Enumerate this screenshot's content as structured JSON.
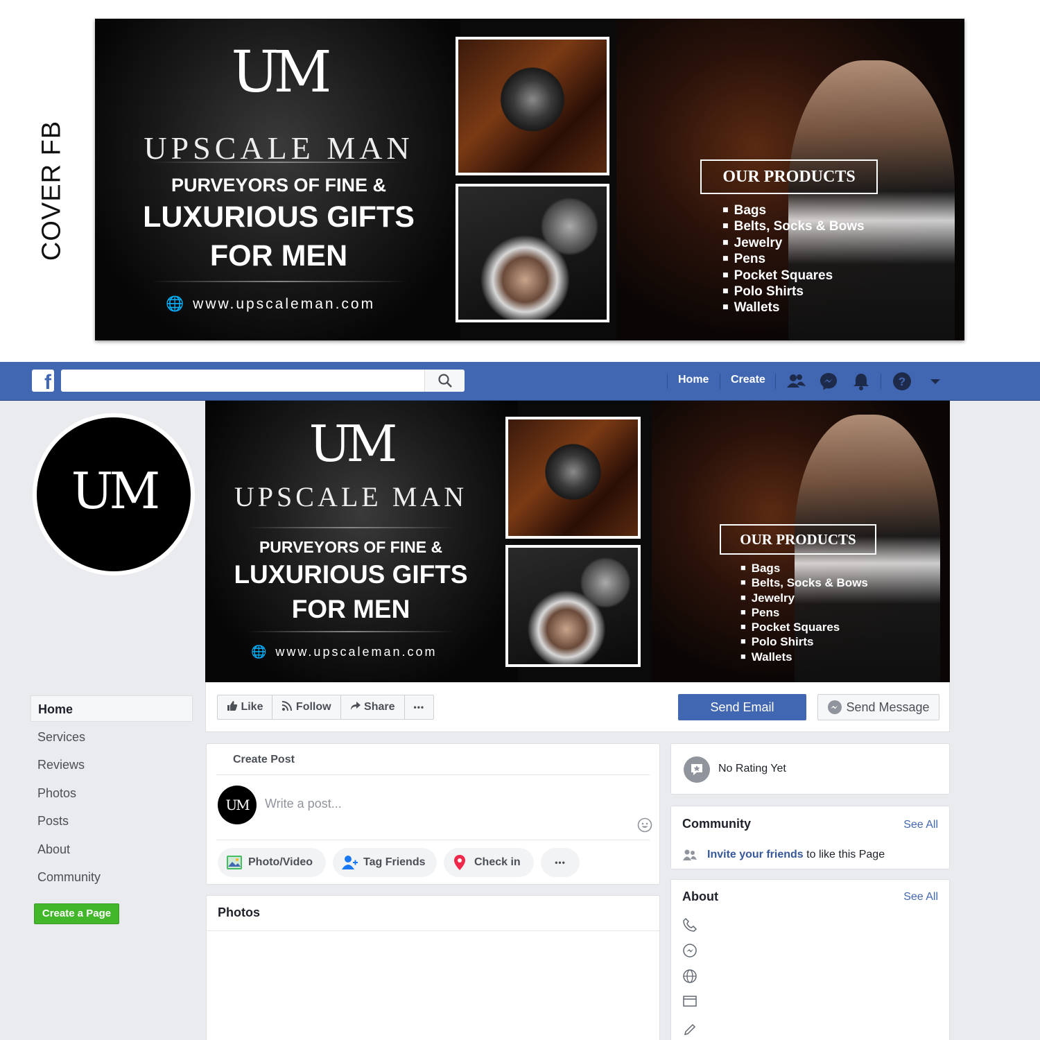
{
  "side_label": "COVER FB",
  "cover": {
    "logo_text": "UM",
    "brand": "UPSCALE MAN",
    "tagline_1": "PURVEYORS OF FINE &",
    "tagline_2": "LUXURIOUS GIFTS",
    "tagline_3": "FOR MEN",
    "website": "www.upscaleman.com",
    "products_heading": "OUR PRODUCTS",
    "products": [
      "Bags",
      "Belts, Socks & Bows",
      "Jewelry",
      "Pens",
      "Pocket Squares",
      "Polo Shirts",
      "Wallets"
    ]
  },
  "navbar": {
    "logo": "f",
    "search_placeholder": "",
    "home": "Home",
    "create": "Create",
    "icons": [
      "friends-icon",
      "messenger-icon",
      "notifications-icon",
      "help-icon",
      "dropdown-icon"
    ]
  },
  "profile": {
    "initials": "UM"
  },
  "leftnav": {
    "items": [
      "Home",
      "Services",
      "Reviews",
      "Photos",
      "Posts",
      "About",
      "Community"
    ],
    "active": "Home",
    "create_page": "Create a Page"
  },
  "action_bar": {
    "like": "Like",
    "follow": "Follow",
    "share": "Share",
    "more": "•••",
    "send_email": "Send Email",
    "send_message": "Send Message"
  },
  "create_post": {
    "title": "Create Post",
    "avatar": "UM",
    "placeholder": "Write a post...",
    "photo_video": "Photo/Video",
    "tag_friends": "Tag Friends",
    "check_in": "Check in",
    "more": "•••"
  },
  "photos": {
    "title": "Photos"
  },
  "rating": {
    "text": "No Rating Yet"
  },
  "community": {
    "title": "Community",
    "see_all": "See All",
    "invite_link": "Invite your friends",
    "invite_rest": " to like this Page"
  },
  "about": {
    "title": "About",
    "see_all": "See All",
    "icons": [
      "phone-icon",
      "messenger-icon",
      "globe-icon",
      "category-icon",
      "edit-icon"
    ]
  },
  "colors": {
    "fb_blue": "#4267b2",
    "page_bg": "#e9ebee",
    "create_green": "#42b72a",
    "link_blue": "#365899"
  }
}
